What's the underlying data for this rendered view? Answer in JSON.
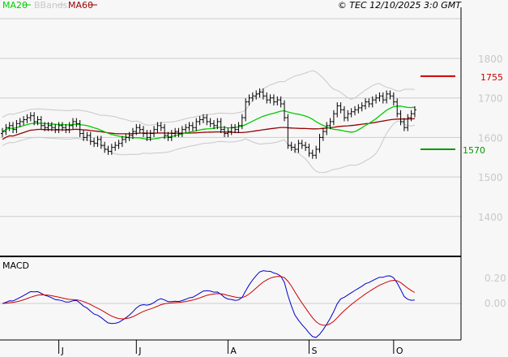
{
  "chart_data": {
    "type": "line",
    "title": "",
    "copyright": "© TEC 12/10/2025 3:0 GMT",
    "legend": [
      {
        "name": "MA20",
        "color": "#00cc00"
      },
      {
        "name": "BBands",
        "color": "#c8c8c8"
      },
      {
        "name": "MA60",
        "color": "#990000"
      }
    ],
    "legend_placement": "top-left",
    "price_axis": {
      "ticks": [
        1400,
        1500,
        1600,
        1700,
        1800
      ],
      "tick_labels": [
        "1400",
        "1500",
        "1600",
        "1700",
        "1800"
      ],
      "ylim": [
        1308,
        1905
      ]
    },
    "levels": [
      {
        "name": "resistance",
        "value": 1755,
        "label": "1755",
        "color": "#cc0000"
      },
      {
        "name": "support",
        "value": 1570,
        "label": "1570",
        "color": "#009900"
      }
    ],
    "macd_panel": {
      "label": "MACD",
      "ticks": [
        0.0,
        0.2
      ],
      "tick_labels": [
        "0.00",
        "0.20"
      ],
      "macd_color": "#0000cc",
      "signal_color": "#cc0000"
    },
    "x_months": [
      {
        "label": "J",
        "index": 16
      },
      {
        "label": "J",
        "index": 38
      },
      {
        "label": "A",
        "index": 64
      },
      {
        "label": "S",
        "index": 87
      },
      {
        "label": "O",
        "index": 111
      }
    ],
    "close": [
      1615,
      1625,
      1630,
      1620,
      1635,
      1640,
      1645,
      1650,
      1655,
      1640,
      1645,
      1630,
      1625,
      1630,
      1625,
      1620,
      1630,
      1625,
      1620,
      1630,
      1640,
      1635,
      1610,
      1600,
      1605,
      1590,
      1585,
      1595,
      1580,
      1570,
      1565,
      1575,
      1580,
      1585,
      1595,
      1600,
      1605,
      1615,
      1625,
      1620,
      1610,
      1600,
      1610,
      1620,
      1630,
      1625,
      1605,
      1600,
      1610,
      1615,
      1610,
      1620,
      1625,
      1630,
      1625,
      1640,
      1645,
      1650,
      1640,
      1635,
      1630,
      1640,
      1620,
      1610,
      1615,
      1625,
      1620,
      1630,
      1650,
      1690,
      1700,
      1705,
      1710,
      1715,
      1705,
      1695,
      1700,
      1690,
      1695,
      1685,
      1650,
      1580,
      1575,
      1570,
      1585,
      1580,
      1575,
      1560,
      1555,
      1570,
      1600,
      1615,
      1630,
      1640,
      1660,
      1680,
      1670,
      1650,
      1660,
      1665,
      1670,
      1675,
      1680,
      1690,
      1685,
      1695,
      1700,
      1705,
      1695,
      1710,
      1705,
      1690,
      1660,
      1640,
      1625,
      1650,
      1660,
      1670
    ]
  }
}
